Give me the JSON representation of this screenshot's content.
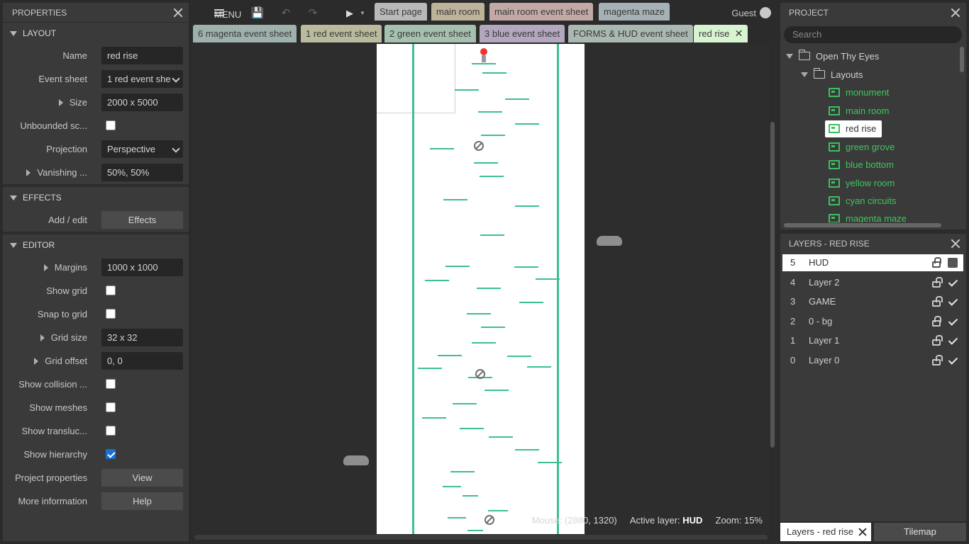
{
  "properties": {
    "title": "PROPERTIES",
    "layout_section": "LAYOUT",
    "name_label": "Name",
    "name_value": "red rise",
    "event_sheet_label": "Event sheet",
    "event_sheet_value": "1 red event she",
    "size_label": "Size",
    "size_value": "2000 x 5000",
    "unbounded_label": "Unbounded sc...",
    "projection_label": "Projection",
    "projection_value": "Perspective",
    "vanishing_label": "Vanishing ...",
    "vanishing_value": "50%, 50%",
    "effects_section": "EFFECTS",
    "addedit_label": "Add / edit",
    "effects_button": "Effects",
    "editor_section": "EDITOR",
    "margins_label": "Margins",
    "margins_value": "1000 x 1000",
    "show_grid_label": "Show grid",
    "snap_grid_label": "Snap to grid",
    "grid_size_label": "Grid size",
    "grid_size_value": "32 x 32",
    "grid_offset_label": "Grid offset",
    "grid_offset_value": "0, 0",
    "show_collision_label": "Show collision ...",
    "show_meshes_label": "Show meshes",
    "show_transluc_label": "Show transluc...",
    "show_hierarchy_label": "Show hierarchy",
    "project_props_label": "Project properties",
    "view_button": "View",
    "more_info_label": "More information",
    "help_button": "Help"
  },
  "topbar": {
    "menu_label": "MENU",
    "tabs_row1": [
      "Start page",
      "main room",
      "main room event sheet",
      "magenta maze"
    ],
    "tabs_row2": [
      "6 magenta event sheet",
      "1 red event sheet",
      "2 green event sheet",
      "3 blue event sheet",
      "FORMS & HUD event sheet",
      "red rise"
    ],
    "user": "Guest"
  },
  "status": {
    "mouse_label": "Mouse:",
    "mouse_value": "(2880, 1320)",
    "layer_label": "Active layer:",
    "layer_value": "HUD",
    "zoom_label": "Zoom:",
    "zoom_value": "15%"
  },
  "project": {
    "title": "PROJECT",
    "search_placeholder": "Search",
    "root": "Open Thy Eyes",
    "layouts_folder": "Layouts",
    "layouts": [
      "monument",
      "main room",
      "red rise",
      "green grove",
      "blue bottom",
      "yellow room",
      "cyan circuits",
      "magenta maze"
    ]
  },
  "layers": {
    "title": "LAYERS - RED RISE",
    "rows": [
      {
        "num": "5",
        "name": "HUD"
      },
      {
        "num": "4",
        "name": "Layer 2"
      },
      {
        "num": "3",
        "name": "GAME"
      },
      {
        "num": "2",
        "name": "0 - bg"
      },
      {
        "num": "1",
        "name": "Layer 1"
      },
      {
        "num": "0",
        "name": "Layer 0"
      }
    ]
  },
  "bottom_tabs": {
    "layers_tab": "Layers - red rise",
    "tilemap_tab": "Tilemap"
  },
  "colors": {
    "accent_green": "#3cbf91",
    "layout_green": "#3cc85a"
  }
}
